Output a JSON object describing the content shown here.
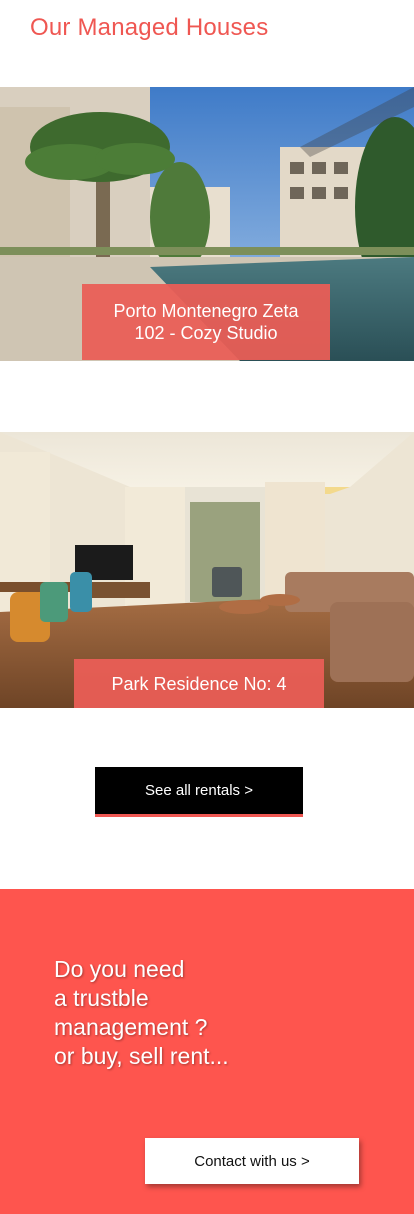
{
  "header": {
    "title": "Our Managed Houses"
  },
  "listings": [
    {
      "label_line1": "Porto Montenegro Zeta",
      "label_line2": "102 - Cozy Studio",
      "image": "pool-courtyard-photo"
    },
    {
      "label": "Park Residence No: 4",
      "image": "living-room-photo"
    }
  ],
  "actions": {
    "see_all_label": "See all rentals >"
  },
  "cta": {
    "line1": "Do you need",
    "line2": "a trustble",
    "line3": "management ?",
    "line4": "or buy, sell rent...",
    "contact_label": "Contact with us >"
  },
  "colors": {
    "accent": "#ef5752",
    "cta_background": "#fe554e",
    "button_dark": "#000000"
  }
}
